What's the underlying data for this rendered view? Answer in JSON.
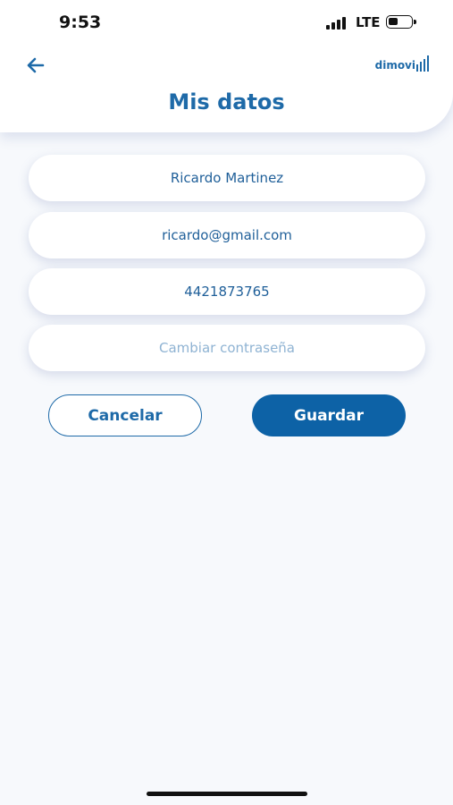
{
  "status_bar": {
    "time": "9:53",
    "network": "LTE",
    "battery_level": 0.45,
    "icons": [
      "signal-icon",
      "battery-icon"
    ]
  },
  "header": {
    "back_icon": "arrow-left-icon",
    "title": "Mis datos",
    "brand": "dimovi"
  },
  "form": {
    "name": "Ricardo Martinez",
    "email": "ricardo@gmail.com",
    "phone": "4421873765",
    "password_placeholder": "Cambiar contraseña"
  },
  "actions": {
    "cancel_label": "Cancelar",
    "save_label": "Guardar"
  },
  "colors": {
    "accent": "#1e6aa8",
    "primary_button": "#0d62a6",
    "background": "#f7f9fc",
    "placeholder": "#8fb3d3"
  }
}
